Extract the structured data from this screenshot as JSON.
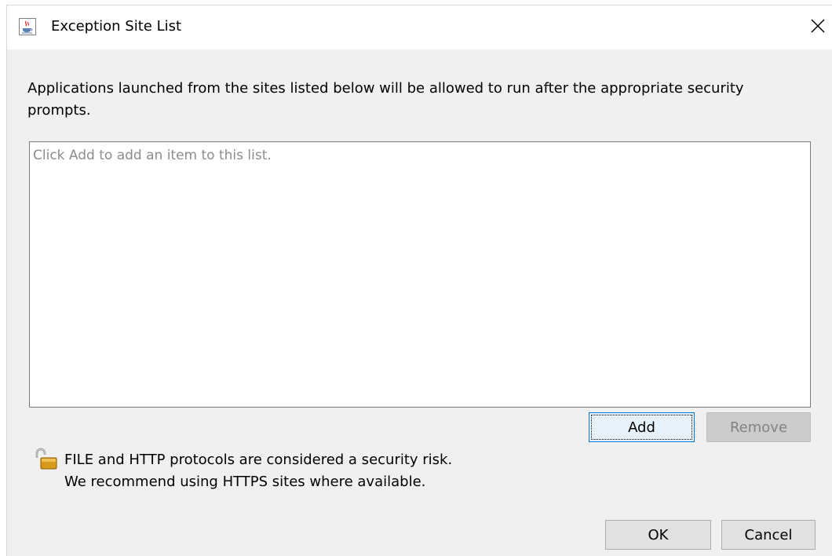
{
  "window": {
    "title": "Exception Site List",
    "title_icon": "java-coffee-cup-icon",
    "close_icon": "close-icon"
  },
  "description": "Applications launched from the sites listed below will be allowed to run after the appropriate security prompts.",
  "site_list": {
    "placeholder": "Click Add to add an item to this list.",
    "items": []
  },
  "buttons": {
    "add": "Add",
    "remove": "Remove",
    "ok": "OK",
    "cancel": "Cancel"
  },
  "warning": {
    "icon": "open-padlock-icon",
    "line1": "FILE and HTTP protocols are considered a security risk.",
    "line2": "We recommend using HTTPS sites where available."
  }
}
